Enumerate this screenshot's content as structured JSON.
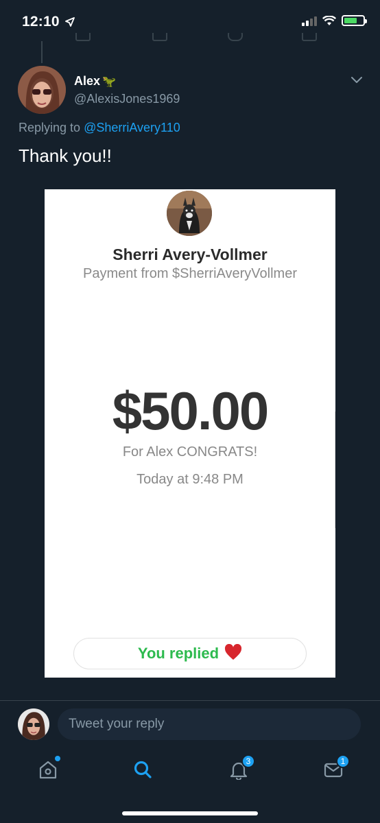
{
  "status_bar": {
    "time": "12:10"
  },
  "tweet": {
    "author_name": "Alex",
    "author_emoji": "🦖",
    "author_handle": "@AlexisJones1969",
    "replying_prefix": "Replying to",
    "replying_to": "@SherriAvery110",
    "text": "Thank you!!"
  },
  "payment_card": {
    "sender_name": "Sherri Avery-Vollmer",
    "subtitle": "Payment from $SherriAveryVollmer",
    "amount": "$50.00",
    "note": "For Alex CONGRATS!",
    "timestamp": "Today at 9:48 PM",
    "reply_status": "You replied",
    "reply_emoji": "❤️"
  },
  "composer": {
    "placeholder": "Tweet your reply"
  },
  "tab_bar": {
    "notifications_badge": "3",
    "messages_badge": "1"
  },
  "colors": {
    "background": "#15202b",
    "accent": "#1da1f2",
    "secondary_text": "#8899a6",
    "success_green": "#2dba4e"
  }
}
